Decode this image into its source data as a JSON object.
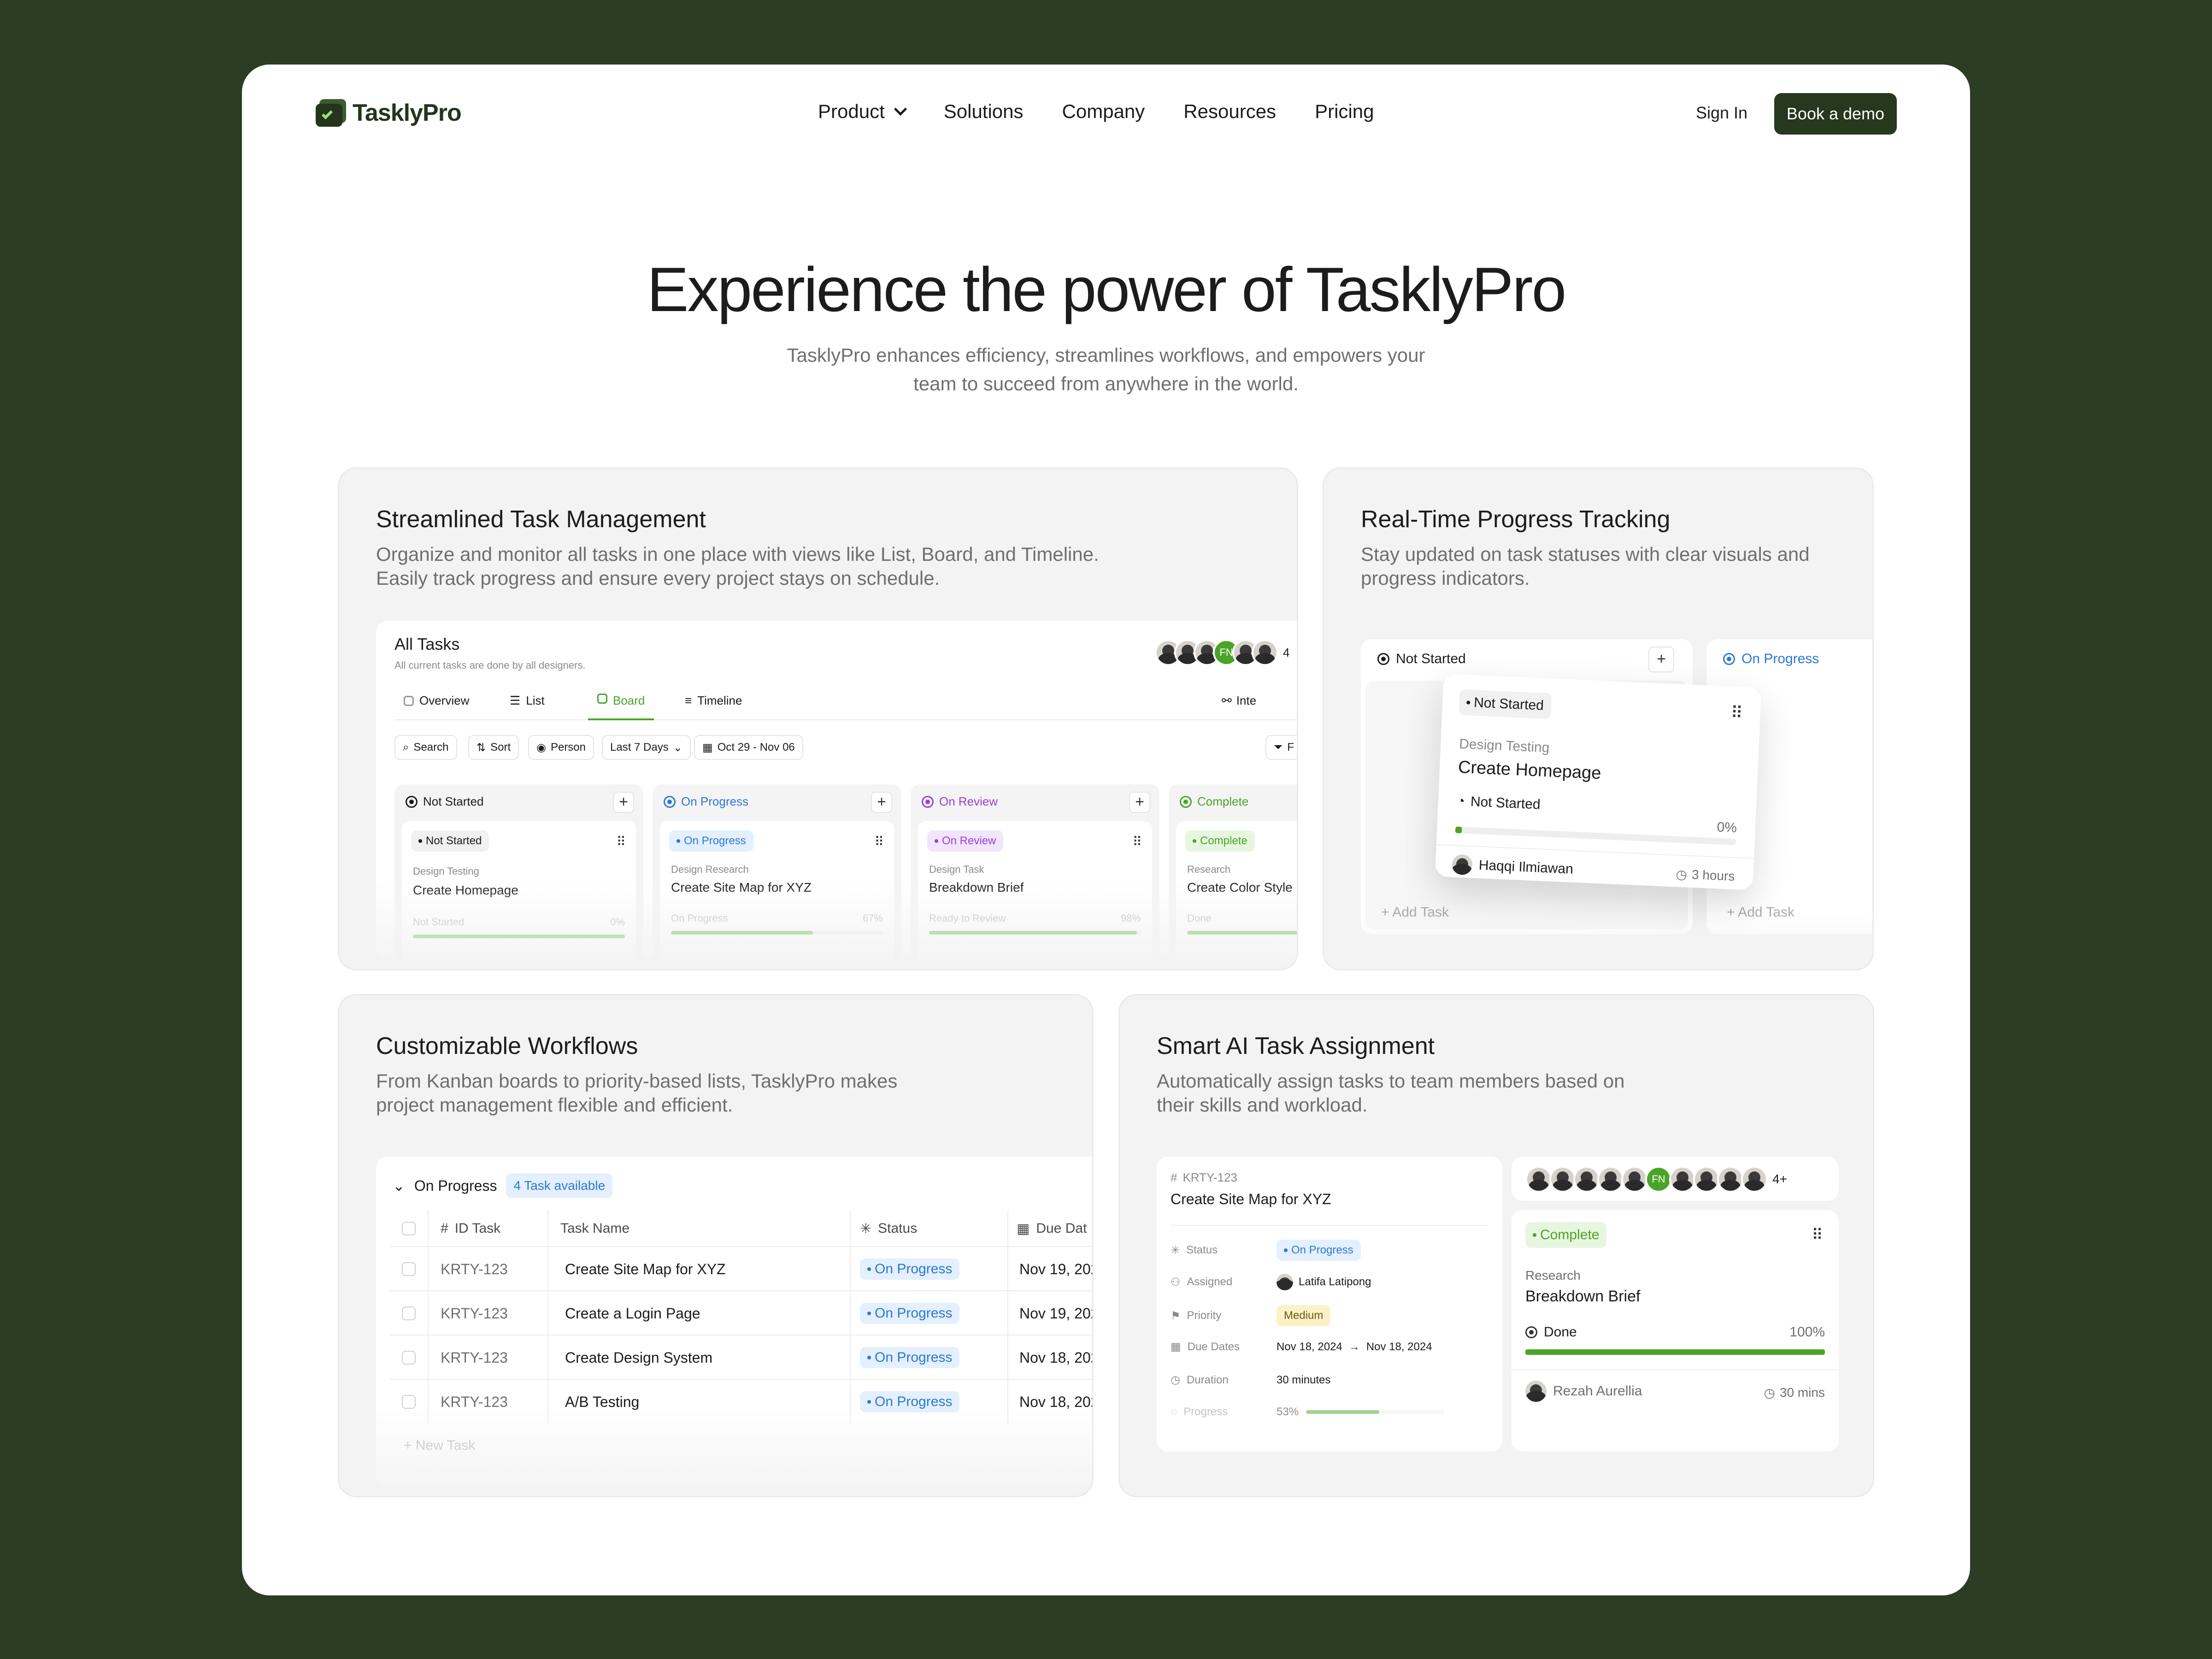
{
  "nav": {
    "logo": "TasklyPro",
    "menu": [
      "Product",
      "Solutions",
      "Company",
      "Resources",
      "Pricing"
    ],
    "sign_in": "Sign In",
    "book_demo": "Book a demo"
  },
  "hero": {
    "title": "Experience the power of TasklyPro",
    "subtitle": "TasklyPro enhances efficiency, streamlines workflows, and empowers your team to succeed from anywhere in the world."
  },
  "card1": {
    "title": "Streamlined Task Management",
    "desc": "Organize and monitor all tasks in one place with views like List, Board, and Timeline. Easily track progress and ensure every project stays on schedule.",
    "board_title": "All Tasks",
    "board_sub": "All current tasks are done by all designers.",
    "avatar_count": "4",
    "tabs": [
      "Overview",
      "List",
      "Board",
      "Timeline"
    ],
    "integrations": "Inte",
    "filters": [
      "Search",
      "Sort",
      "Person",
      "Last 7 Days",
      "Oct 29 - Nov 06"
    ],
    "filter_right": "F",
    "columns": [
      {
        "name": "Not Started",
        "color": "#1c1c1c",
        "pill": "Not Started",
        "category": "Design Testing",
        "task": "Create Homepage",
        "status": "Not Started",
        "pct": "0%",
        "progress": 0
      },
      {
        "name": "On Progress",
        "color": "#2a78d6",
        "pill": "On Progress",
        "category": "Design Research",
        "task": "Create Site Map for XYZ",
        "status": "On Progress",
        "pct": "67%",
        "progress": 67
      },
      {
        "name": "On Review",
        "color": "#9a3fd6",
        "pill": "On Review",
        "category": "Design Task",
        "task": "Breakdown Brief",
        "status": "Ready to Review",
        "pct": "98%",
        "progress": 98
      },
      {
        "name": "Complete",
        "color": "#4aa428",
        "pill": "Complete",
        "category": "Research",
        "task": "Create Color Style",
        "status": "Done",
        "pct": "",
        "progress": 100
      }
    ]
  },
  "card2": {
    "title": "Real-Time Progress Tracking",
    "desc": "Stay updated on task statuses with clear visuals and progress indicators.",
    "col_left": "Not Started",
    "col_right": "On Progress",
    "add_task": "Add Task",
    "float": {
      "pill": "Not Started",
      "category": "Design Testing",
      "task": "Create Homepage",
      "status": "Not Started",
      "pct": "0%",
      "assignee": "Haqqi Ilmiawan",
      "time": "3 hours"
    }
  },
  "card3": {
    "title": "Customizable Workflows",
    "desc": "From Kanban boards to priority-based lists, TasklyPro makes project management flexible and efficient.",
    "group": "On Progress",
    "badge": "4 Task available",
    "headers": [
      "ID Task",
      "Task Name",
      "Status",
      "Due Dat"
    ],
    "rows": [
      {
        "id": "KRTY-123",
        "name": "Create Site Map for XYZ",
        "status": "On Progress",
        "due": "Nov 19, 202"
      },
      {
        "id": "KRTY-123",
        "name": "Create a Login Page",
        "status": "On Progress",
        "due": "Nov 19, 202"
      },
      {
        "id": "KRTY-123",
        "name": "Create Design System",
        "status": "On Progress",
        "due": "Nov 18, 202"
      },
      {
        "id": "KRTY-123",
        "name": "A/B Testing",
        "status": "On Progress",
        "due": "Nov 18, 202"
      }
    ],
    "new_task": "New Task"
  },
  "card4": {
    "title": "Smart AI Task Assignment",
    "desc": "Automatically assign tasks to team members based on their skills and workload.",
    "detail": {
      "id": "KRTY-123",
      "task": "Create Site Map for XYZ",
      "rows": [
        {
          "k": "Status",
          "v": "On Progress"
        },
        {
          "k": "Assigned",
          "v": "Latifa Latipong"
        },
        {
          "k": "Priority",
          "v": "Medium"
        },
        {
          "k": "Due Dates",
          "v": "Nov 18, 2024",
          "v2": "Nov 18, 2024"
        },
        {
          "k": "Duration",
          "v": "30 minutes"
        },
        {
          "k": "Progress",
          "v": "53%"
        }
      ],
      "progress": 53
    },
    "avatars_more": "4+",
    "avatar_initials": "FN",
    "mini": {
      "pill": "Complete",
      "category": "Research",
      "task": "Breakdown Brief",
      "status": "Done",
      "pct": "100%",
      "progress": 100,
      "assignee": "Rezah Aurellia",
      "time": "30 mins"
    }
  }
}
